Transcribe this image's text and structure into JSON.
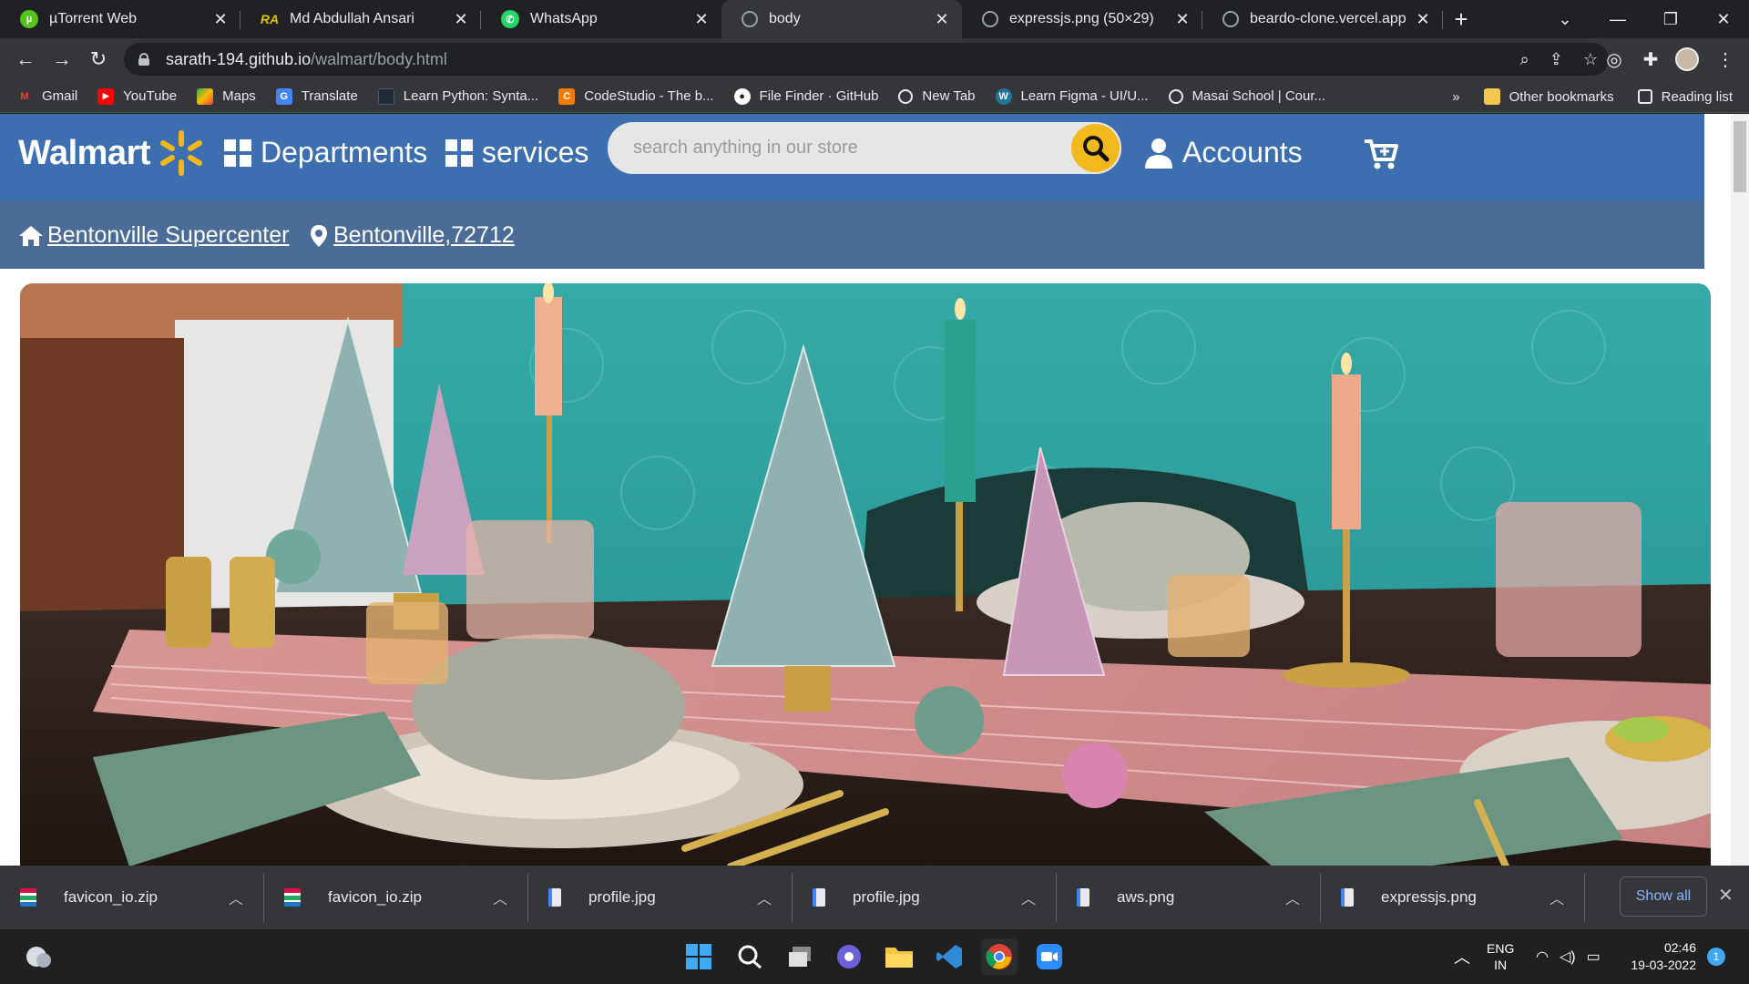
{
  "browser": {
    "tabs": [
      {
        "title": "µTorrent Web",
        "icon": "utorrent-icon",
        "color": "#52c41a"
      },
      {
        "title": "Md Abdullah Ansari",
        "icon": "ra-icon",
        "color": "#e0c000"
      },
      {
        "title": "WhatsApp",
        "icon": "whatsapp-icon",
        "color": "#25d366"
      },
      {
        "title": "body",
        "icon": "globe-icon",
        "color": "#9aa0a6",
        "active": true
      },
      {
        "title": "expressjs.png (50×29)",
        "icon": "globe-icon",
        "color": "#9aa0a6"
      },
      {
        "title": "beardo-clone.vercel.app",
        "icon": "globe-icon",
        "color": "#9aa0a6"
      }
    ],
    "url_host": "sarath-194.github.io",
    "url_path": "/walmart/body.html",
    "bookmarks": [
      {
        "label": "Gmail",
        "color": "#ea4335",
        "glyph": "M"
      },
      {
        "label": "YouTube",
        "color": "#ff0000",
        "glyph": "▶"
      },
      {
        "label": "Maps",
        "color": "#34a853",
        "glyph": "◆"
      },
      {
        "label": "Translate",
        "color": "#4285f4",
        "glyph": "G"
      },
      {
        "label": "Learn Python: Synta...",
        "color": "#1e2a38",
        "glyph": ""
      },
      {
        "label": "CodeStudio - The b...",
        "color": "#f57c00",
        "glyph": "C"
      },
      {
        "label": "File Finder · GitHub",
        "color": "#ffffff",
        "glyph": "●"
      },
      {
        "label": "New Tab",
        "color": "#9aa0a6",
        "glyph": "◎"
      },
      {
        "label": "Learn Figma - UI/U...",
        "color": "#21759b",
        "glyph": "W"
      },
      {
        "label": "Masai School | Cour...",
        "color": "#9aa0a6",
        "glyph": "◎"
      }
    ],
    "bookmarks_overflow": "»",
    "other_bookmarks": "Other bookmarks",
    "reading_list": "Reading list"
  },
  "page": {
    "logo": "Walmart",
    "nav_departments": "Departments",
    "nav_services": "services",
    "search_placeholder": "search anything in our store",
    "accounts": "Accounts",
    "store_name": "Bentonville Supercenter",
    "location": "Bentonville,72712",
    "colors": {
      "header": "#3c6eb0",
      "subbar": "#4a6c97",
      "spark": "#f2b81c"
    }
  },
  "downloads": {
    "items": [
      {
        "name": "favicon_io.zip",
        "icon": "zip-file-icon"
      },
      {
        "name": "favicon_io.zip",
        "icon": "zip-file-icon"
      },
      {
        "name": "profile.jpg",
        "icon": "image-file-icon"
      },
      {
        "name": "profile.jpg",
        "icon": "image-file-icon"
      },
      {
        "name": "aws.png",
        "icon": "image-file-icon"
      },
      {
        "name": "expressjs.png",
        "icon": "image-file-icon"
      }
    ],
    "show_all": "Show all"
  },
  "taskbar": {
    "lang_top": "ENG",
    "lang_bottom": "IN",
    "time": "02:46",
    "date": "19-03-2022",
    "notification_count": "1"
  }
}
